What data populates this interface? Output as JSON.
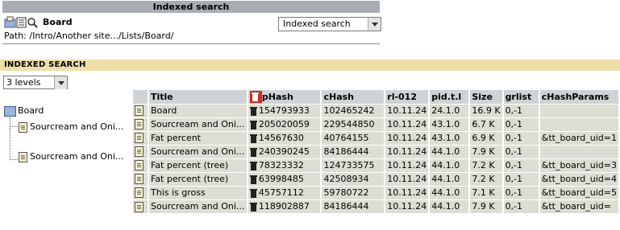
{
  "topbar": {
    "title": "Indexed search"
  },
  "header": {
    "board_title": "Board",
    "path": "Path: /Intro/Another site.../Lists/Board/"
  },
  "view_select": {
    "value": "Indexed search"
  },
  "section": {
    "title": "INDEXED SEARCH"
  },
  "levels_select": {
    "value": "3 levels"
  },
  "tree": {
    "root": "Board",
    "children": [
      "Sourcream and Oni...",
      "Sourcream and Oni..."
    ]
  },
  "table": {
    "headers": [
      "Title",
      "pHash",
      "cHash",
      "rl-012",
      "pid.t.l",
      "Size",
      "grlist",
      "cHashParams"
    ],
    "rows": [
      {
        "title": "Board",
        "phash": "154793933",
        "chash": "102465242",
        "rl": "10.11.24",
        "pid": "24.1.0",
        "size": "16.9 K",
        "grlist": "0,-1",
        "params": ""
      },
      {
        "title": "Sourcream and Oni...",
        "phash": "205020059",
        "chash": "229544850",
        "rl": "10.11.24",
        "pid": "43.1.0",
        "size": "6.7 K",
        "grlist": "0,-1",
        "params": ""
      },
      {
        "title": "Fat percent",
        "phash": "14567630",
        "chash": "40764155",
        "rl": "10.11.24",
        "pid": "43.1.0",
        "size": "6.9 K",
        "grlist": "0,-1",
        "params": "&tt_board_uid=1"
      },
      {
        "title": "Sourcream and Oni...",
        "phash": "240390245",
        "chash": "84186444",
        "rl": "10.11.24",
        "pid": "44.1.0",
        "size": "7.9 K",
        "grlist": "0,-1",
        "params": ""
      },
      {
        "title": "Fat percent (tree)",
        "phash": "78323332",
        "chash": "124733575",
        "rl": "10.11.24",
        "pid": "44.1.0",
        "size": "7.2 K",
        "grlist": "0,-1",
        "params": "&tt_board_uid=3"
      },
      {
        "title": "Fat percent (tree)",
        "phash": "63998485",
        "chash": "42508934",
        "rl": "10.11.24",
        "pid": "44.1.0",
        "size": "7.2 K",
        "grlist": "0,-1",
        "params": "&tt_board_uid=4"
      },
      {
        "title": "This is gross",
        "phash": "45757112",
        "chash": "59780722",
        "rl": "10.11.24",
        "pid": "44.1.0",
        "size": "7.1 K",
        "grlist": "0,-1",
        "params": "&tt_board_uid=5"
      },
      {
        "title": "Sourcream and Oni...",
        "phash": "118902887",
        "chash": "84186444",
        "rl": "10.11.24",
        "pid": "44.1.0",
        "size": "7.9 K",
        "grlist": "0,-1",
        "params": "&tt_board_uid="
      }
    ]
  }
}
